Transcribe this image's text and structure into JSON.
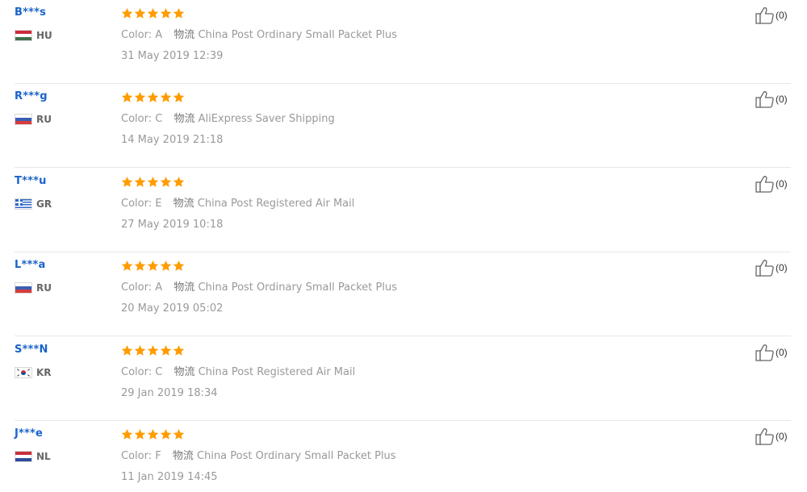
{
  "reviews": [
    {
      "user": "B***s",
      "country_code": "HU",
      "flag": "hungary-flag",
      "rating": 5,
      "color_label": "Color:",
      "color_value": "A",
      "logistics_label": "物流",
      "logistics_value": "China Post Ordinary Small Packet Plus",
      "date": "31 May 2019 12:39",
      "helpful": "(0)"
    },
    {
      "user": "R***g",
      "country_code": "RU",
      "flag": "russia-flag",
      "rating": 5,
      "color_label": "Color:",
      "color_value": "C",
      "logistics_label": "物流",
      "logistics_value": "AliExpress Saver Shipping",
      "date": "14 May 2019 21:18",
      "helpful": "(0)"
    },
    {
      "user": "T***u",
      "country_code": "GR",
      "flag": "greece-flag",
      "rating": 5,
      "color_label": "Color:",
      "color_value": "E",
      "logistics_label": "物流",
      "logistics_value": "China Post Registered Air Mail",
      "date": "27 May 2019 10:18",
      "helpful": "(0)"
    },
    {
      "user": "L***a",
      "country_code": "RU",
      "flag": "russia-flag",
      "rating": 5,
      "color_label": "Color:",
      "color_value": "A",
      "logistics_label": "物流",
      "logistics_value": "China Post Ordinary Small Packet Plus",
      "date": "20 May 2019 05:02",
      "helpful": "(0)"
    },
    {
      "user": "S***N",
      "country_code": "KR",
      "flag": "south-korea-flag",
      "rating": 5,
      "color_label": "Color:",
      "color_value": "C",
      "logistics_label": "物流",
      "logistics_value": "China Post Registered Air Mail",
      "date": "29 Jan 2019 18:34",
      "helpful": "(0)"
    },
    {
      "user": "J***e",
      "country_code": "NL",
      "flag": "netherlands-flag",
      "rating": 5,
      "color_label": "Color:",
      "color_value": "F",
      "logistics_label": "物流",
      "logistics_value": "China Post Ordinary Small Packet Plus",
      "date": "11 Jan 2019 14:45",
      "helpful": "(0)"
    }
  ],
  "colors": {
    "user_link": "#1a63c9",
    "star": "#ff9c00",
    "meta_text": "#999999",
    "divider": "#e8e8e8"
  },
  "icons": {
    "star": "star-icon",
    "helpful": "thumbs-up-icon"
  }
}
